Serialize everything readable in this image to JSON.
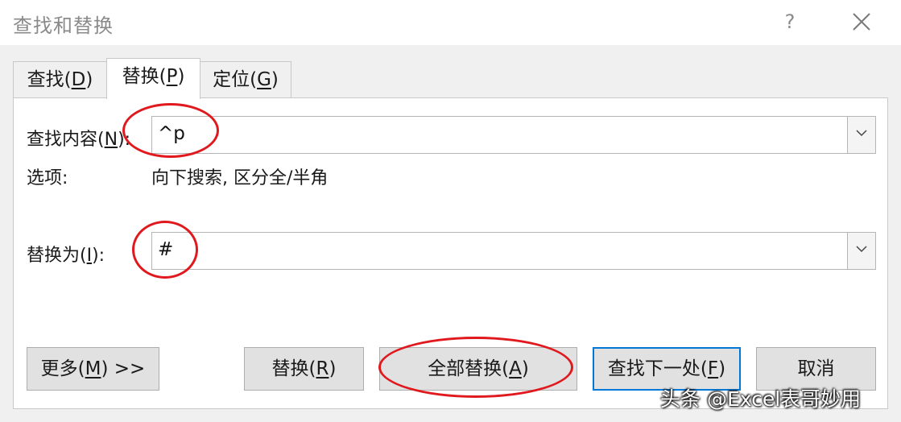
{
  "window": {
    "title": "查找和替换",
    "help_label": "?"
  },
  "tabs": [
    {
      "label": "查找(",
      "key": "D",
      "suffix": ")"
    },
    {
      "label": "替换(",
      "key": "P",
      "suffix": ")"
    },
    {
      "label": "定位(",
      "key": "G",
      "suffix": ")"
    }
  ],
  "find": {
    "label": "查找内容(",
    "key": "N",
    "suffix": "):",
    "value": "^p"
  },
  "options": {
    "label": "选项:",
    "value": "向下搜索, 区分全/半角"
  },
  "replace": {
    "label": "替换为(",
    "key": "I",
    "suffix": "):",
    "value": "#"
  },
  "buttons": {
    "more": {
      "label": "更多(",
      "key": "M",
      "suffix": ") >>"
    },
    "replace": {
      "label": "替换(",
      "key": "R",
      "suffix": ")"
    },
    "replace_all": {
      "label": "全部替换(",
      "key": "A",
      "suffix": ")"
    },
    "find_next": {
      "label": "查找下一处(",
      "key": "F",
      "suffix": ")"
    },
    "cancel": {
      "label": "取消"
    }
  },
  "watermark": "头条 @Excel表哥妙用",
  "colors": {
    "annotation_red": "#e0191e",
    "accent_blue": "#0078d7"
  }
}
